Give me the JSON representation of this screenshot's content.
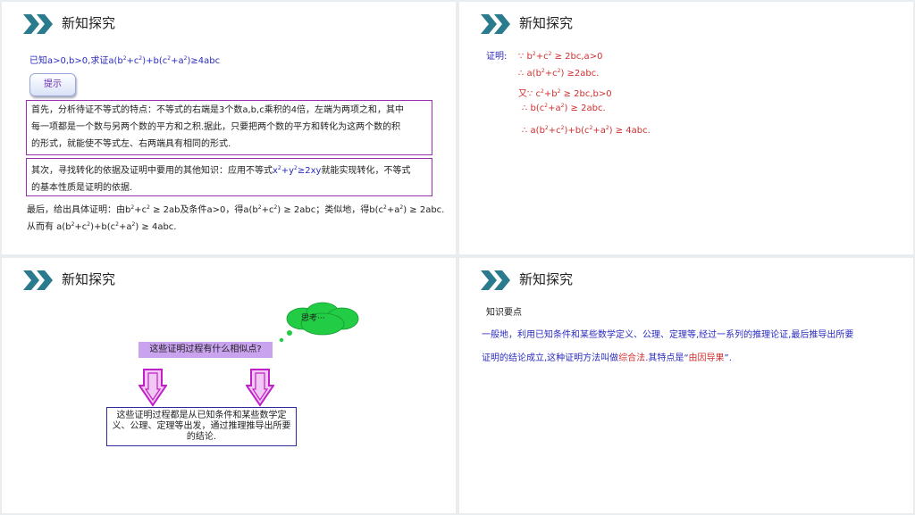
{
  "panels": [
    {
      "title": "新知探究"
    },
    {
      "title": "新知探究"
    },
    {
      "title": "新知探究"
    },
    {
      "title": "新知探究"
    }
  ],
  "p1": {
    "problem": [
      "已知a>0,b>0,求证a(b",
      "2",
      "+c",
      "2",
      ")+b(c",
      "2",
      "+a",
      "2",
      ")≥4abc"
    ],
    "hint_button": "提示",
    "box1": [
      "首先，分析待证不等式的特点：不等式的右端是3个数a,b,c乘积的4倍，左端为两项之和，其中",
      "每一项都是一个数与另两个数的平方和之积.据此，只要把两个数的平方和转化为这两个数的积",
      "的形式，就能使不等式左、右两端具有相同的形式."
    ],
    "box2_line1_pre": "其次，寻找转化的依据及证明中要用的其他知识：应用不等式",
    "box2_line1_formula": [
      "x",
      "2",
      "+y",
      "2",
      "≥2xy"
    ],
    "box2_line1_post": "就能实现转化，不等式",
    "box2_line2": "的基本性质是证明的依据.",
    "final1": [
      "最后，给出具体证明：由b",
      "2",
      "+c",
      "2",
      " ≥ 2ab及条件a>0，得a(b",
      "2",
      "+c",
      "2",
      ") ≥ 2abc；类似地，得b(c",
      "2",
      "+a",
      "2",
      ") ≥ 2abc."
    ],
    "final2": [
      "从而有 a(b",
      "2",
      "+c",
      "2",
      ")+b(c",
      "2",
      "+a",
      "2",
      ") ≥ 4abc."
    ]
  },
  "p2": {
    "label": "证明:",
    "lines": [
      [
        "∵ b",
        "2",
        "+c",
        "2",
        " ≥ 2bc,a>0"
      ],
      [
        "∴ a(b",
        "2",
        "+c",
        "2",
        ") ≥2abc."
      ],
      [
        "又∵ c",
        "2",
        "+b",
        "2",
        " ≥ 2bc,b>0"
      ],
      [
        "∴ b(c",
        "2",
        "+a",
        "2",
        ") ≥ 2abc."
      ],
      [
        "∴ a(b",
        "2",
        "+c",
        "2",
        ")+b(c",
        "2",
        "+a",
        "2",
        ") ≥ 4abc."
      ]
    ]
  },
  "p3": {
    "cloud_text": "思考···",
    "question": "这些证明过程有什么相似点?",
    "answer": "这些证明过程都是从已知条件和某些数学定义、公理、定理等出发，通过推理推导出所要的结论."
  },
  "p4": {
    "heading": "知识要点",
    "line1": "一般地，利用已知条件和某些数学定义、公理、定理等,经过一系列的推理论证,最后推导出所要",
    "line2_pre": "证明的结论成立,这种证明方法叫做",
    "line2_term": "综合法",
    "line2_mid": ".其特点是“",
    "line2_feature": "由因导果",
    "line2_post": "”."
  },
  "colors": {
    "chevron": "#2a7b8e",
    "blue_text": "#2b2bbf",
    "red_text": "#d03030",
    "box_border": "#9b2fb4",
    "cloud": "#22cc44"
  }
}
